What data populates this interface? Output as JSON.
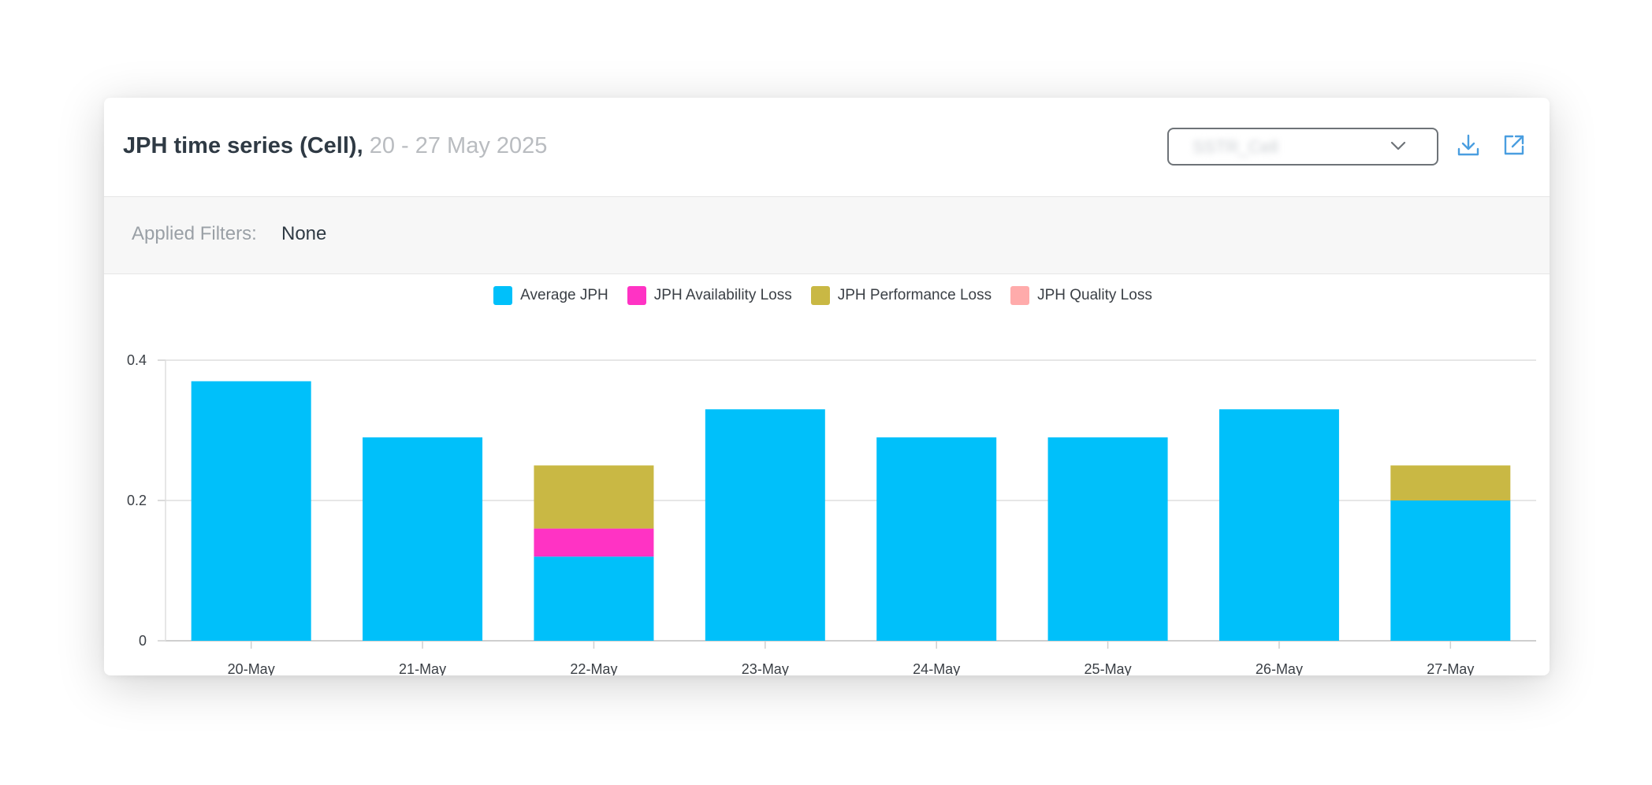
{
  "header": {
    "title": "JPH time series (Cell),",
    "date_range": "20 - 27 May 2025",
    "selector_value": "SSTR_Cell",
    "selector_icon": "chevron-down-icon",
    "download_icon": "download-icon",
    "open_icon": "external-link-icon"
  },
  "filters": {
    "label": "Applied Filters:",
    "value": "None"
  },
  "colors": {
    "average_jph": "#00c0fa",
    "availability_loss": "#ff33c4",
    "performance_loss": "#c9b844",
    "quality_loss": "#ffabab",
    "accent": "#4a9ee0"
  },
  "chart_data": {
    "type": "bar",
    "stacked": true,
    "categories": [
      "20-May",
      "21-May",
      "22-May",
      "23-May",
      "24-May",
      "25-May",
      "26-May",
      "27-May"
    ],
    "series": [
      {
        "name": "Average JPH",
        "color": "#00c0fa",
        "values": [
          0.37,
          0.29,
          0.12,
          0.33,
          0.29,
          0.29,
          0.33,
          0.2
        ]
      },
      {
        "name": "JPH Availability Loss",
        "color": "#ff33c4",
        "values": [
          0,
          0,
          0.04,
          0,
          0,
          0,
          0,
          0
        ]
      },
      {
        "name": "JPH Performance Loss",
        "color": "#c9b844",
        "values": [
          0,
          0,
          0.09,
          0,
          0,
          0,
          0,
          0.05
        ]
      },
      {
        "name": "JPH Quality Loss",
        "color": "#ffabab",
        "values": [
          0,
          0,
          0,
          0,
          0,
          0,
          0,
          0
        ]
      }
    ],
    "ylim": [
      0,
      0.4
    ],
    "yticks": [
      "0",
      "0.2",
      "0.4"
    ],
    "ytick_values": [
      0,
      0.2,
      0.4
    ],
    "grid": true,
    "legend_position": "top-center"
  }
}
